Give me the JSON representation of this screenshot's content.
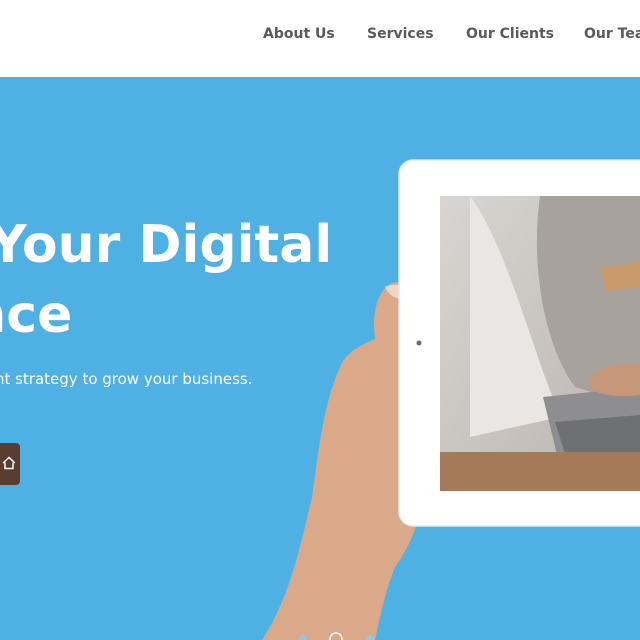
{
  "nav": {
    "items": [
      {
        "label": "About Us"
      },
      {
        "label": "Services"
      },
      {
        "label": "Our Clients"
      },
      {
        "label": "Our Team"
      }
    ]
  },
  "hero": {
    "headline_line1": "Boost Your Digital",
    "headline_line2": "Presence",
    "subtext": "We help you find the right strategy to grow your business.",
    "cta_icon": "home-icon"
  },
  "carousel": {
    "slides": 3,
    "active_index": 1
  },
  "colors": {
    "hero_background": "#4fb0e3",
    "nav_background": "#ffffff",
    "nav_text": "#5a5a5a",
    "cta_background": "#5a3d2f",
    "text_light": "#ffffff"
  }
}
